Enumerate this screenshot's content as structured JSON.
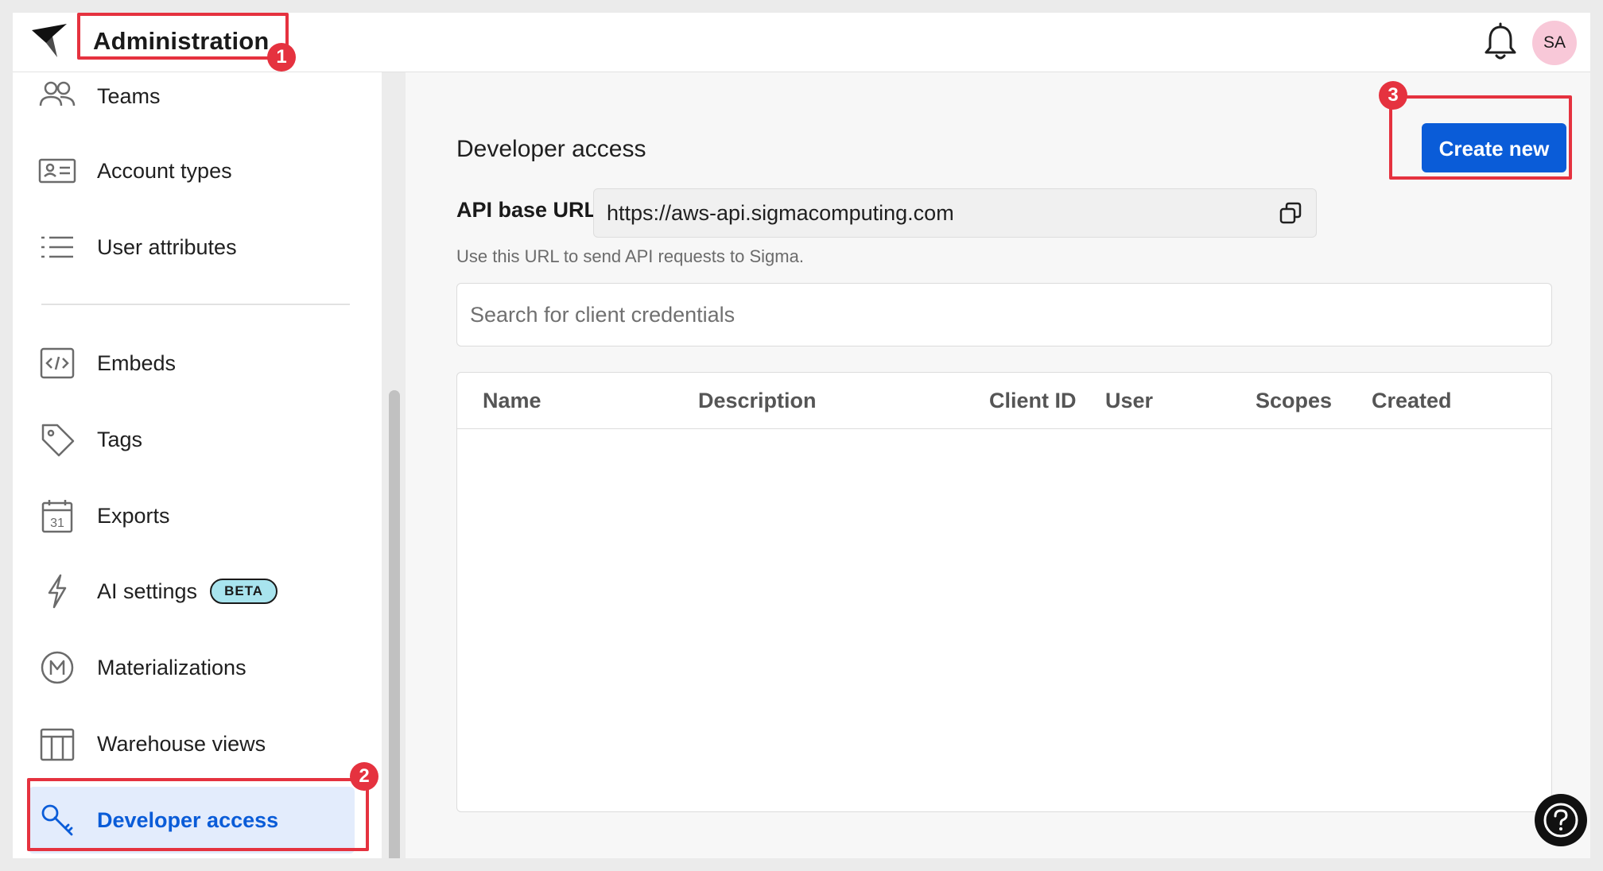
{
  "header": {
    "title": "Administration",
    "logo_icon": "sigma-logo-icon",
    "notification_icon": "bell-icon",
    "avatar_initials": "SA"
  },
  "sidebar": {
    "items": [
      {
        "label": "Teams",
        "icon": "teams-icon"
      },
      {
        "label": "Account types",
        "icon": "id-card-icon"
      },
      {
        "label": "User attributes",
        "icon": "list-icon"
      },
      {
        "label": "Embeds",
        "icon": "code-icon"
      },
      {
        "label": "Tags",
        "icon": "tag-icon"
      },
      {
        "label": "Exports",
        "icon": "calendar-icon"
      },
      {
        "label": "AI settings",
        "icon": "lightning-icon",
        "badge": "BETA"
      },
      {
        "label": "Materializations",
        "icon": "materialization-icon"
      },
      {
        "label": "Warehouse views",
        "icon": "table-layout-icon"
      },
      {
        "label": "Developer access",
        "icon": "key-icon",
        "active": true
      }
    ]
  },
  "main": {
    "title": "Developer access",
    "create_button": "Create new",
    "api": {
      "label": "API base URL",
      "value": "https://aws-api.sigmacomputing.com",
      "help": "Use this URL to send API requests to Sigma."
    },
    "search": {
      "placeholder": "Search for client credentials"
    },
    "table": {
      "columns": [
        "Name",
        "Description",
        "Client ID",
        "User",
        "Scopes",
        "Created"
      ],
      "rows": []
    },
    "help_icon": "question-mark-icon"
  },
  "annotations": [
    "1",
    "2",
    "3"
  ],
  "colors": {
    "primary": "#0a5cd8",
    "active_bg": "#e3ecfc",
    "annotation": "#e5323f",
    "badge_bg": "#a8e4ee",
    "avatar_bg": "#f8c8d8"
  }
}
